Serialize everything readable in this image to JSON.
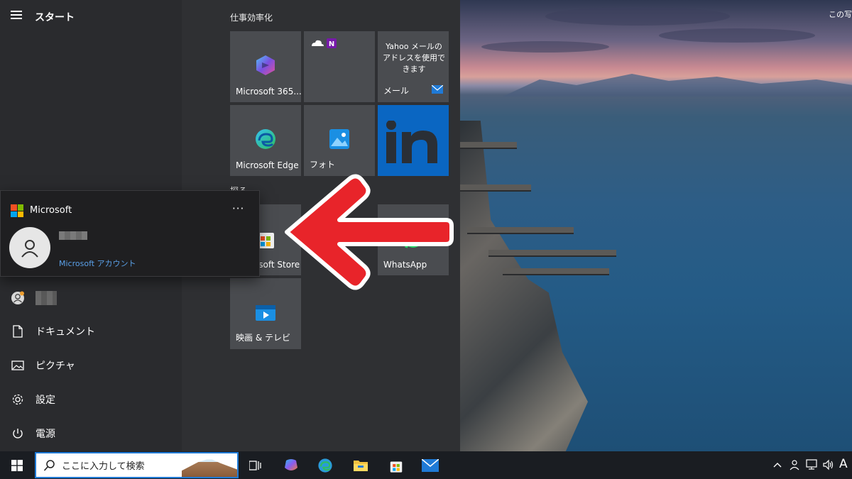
{
  "desktop": {
    "corner_label": "この写"
  },
  "start_menu": {
    "title": "スタート",
    "rail": [
      {
        "label": "",
        "icon": "user-icon"
      },
      {
        "label": "ドキュメント",
        "icon": "document-icon"
      },
      {
        "label": "ピクチャ",
        "icon": "picture-icon"
      },
      {
        "label": "設定",
        "icon": "gear-icon"
      },
      {
        "label": "電源",
        "icon": "power-icon"
      }
    ],
    "groups": {
      "work": "仕事効率化",
      "explore": "探る"
    },
    "tiles": [
      {
        "label": "Microsoft 365...",
        "icon": "microsoft-365-icon"
      },
      {
        "label": "",
        "icon": "onedrive-onenote-icon"
      },
      {
        "label": "メール",
        "text": "Yahoo メールのアドレスを使用できます",
        "icon": "mail-icon"
      },
      {
        "label": "Microsoft Edge",
        "icon": "edge-icon"
      },
      {
        "label": "フォト",
        "icon": "photos-icon"
      },
      {
        "label": "",
        "icon": "linkedin-icon",
        "color": "#0a66c2"
      },
      {
        "label": "Microsoft Store",
        "icon": "store-icon"
      },
      {
        "label": "WhatsApp",
        "icon": "whatsapp-icon"
      },
      {
        "label": "映画 & テレビ",
        "icon": "movies-tv-icon"
      }
    ]
  },
  "account_flyout": {
    "brand": "Microsoft",
    "more": "···",
    "account_link": "Microsoft アカウント"
  },
  "annotation": {
    "arrow_color": "#e8242a"
  },
  "taskbar": {
    "search_placeholder": "ここに入力して検索",
    "ime_indicator": "A",
    "pinned": [
      "task-view-icon",
      "copilot-icon",
      "edge-icon",
      "file-explorer-icon",
      "store-icon",
      "mail-icon"
    ],
    "tray": [
      "chevron-up-icon",
      "people-icon",
      "network-icon",
      "volume-icon"
    ]
  },
  "colors": {
    "accent": "#1f7ad6",
    "tile": "#4a4c50",
    "start_bg": "#2f3033"
  }
}
